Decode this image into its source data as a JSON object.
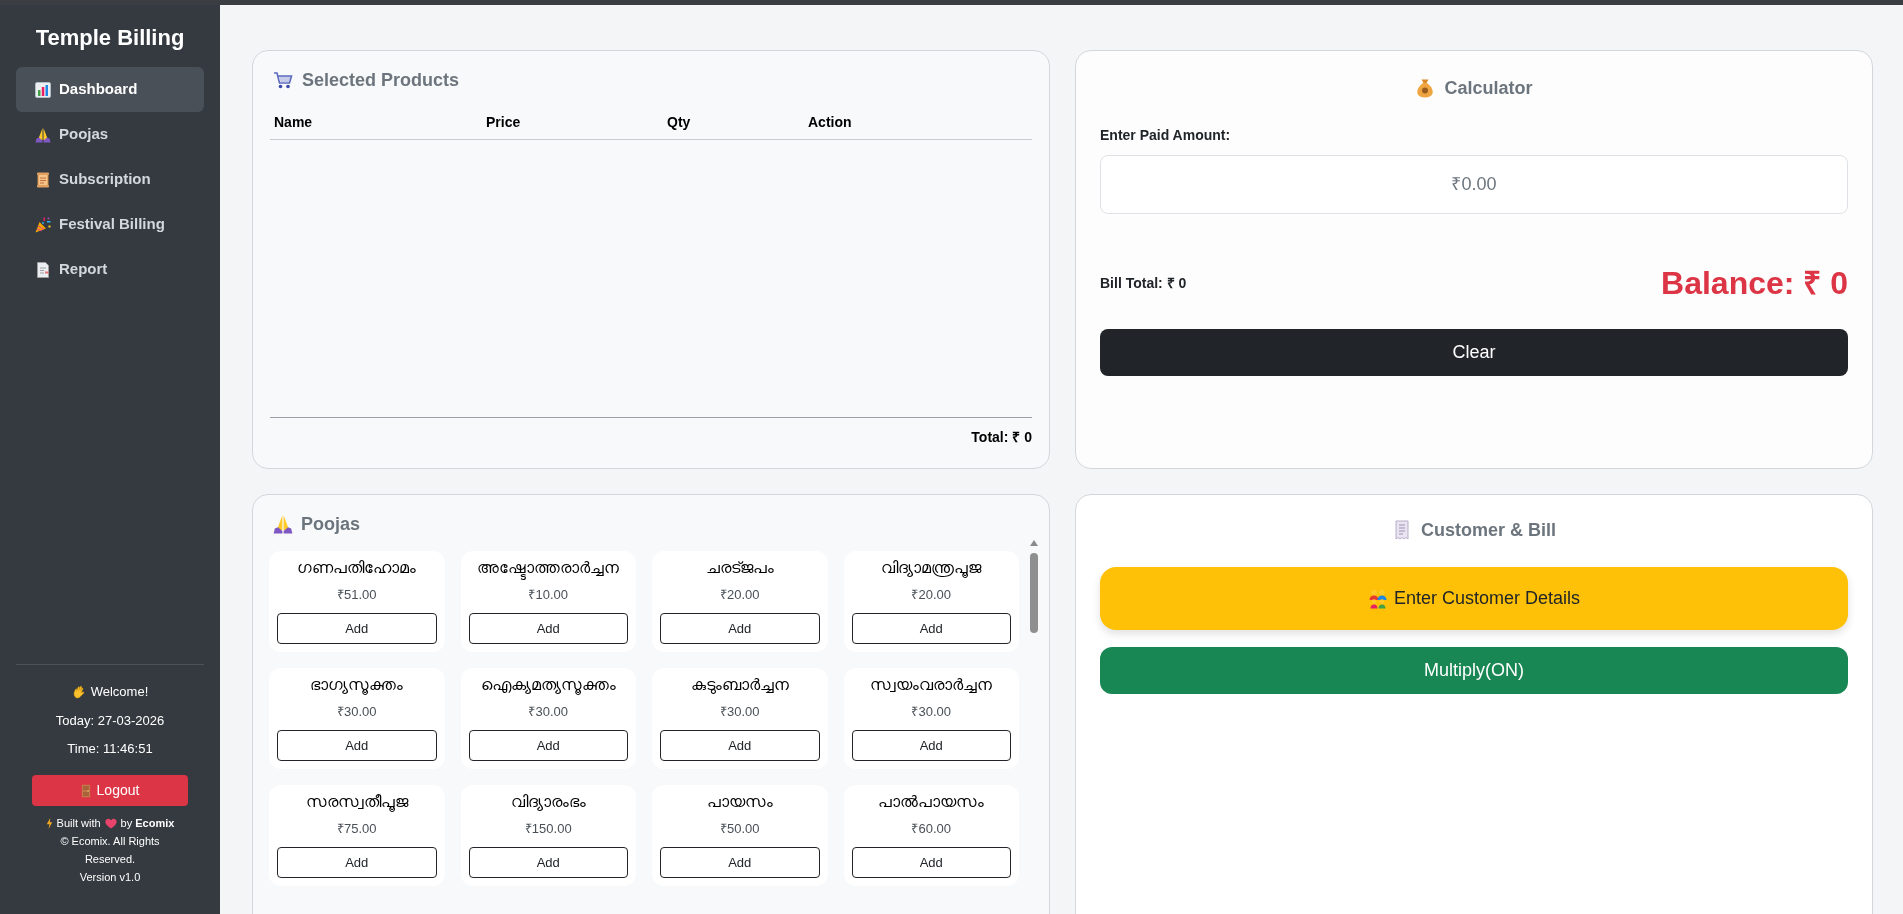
{
  "sidebar": {
    "title": "Temple Billing",
    "items": [
      {
        "label": "Dashboard",
        "selected": true
      },
      {
        "label": "Poojas",
        "selected": false
      },
      {
        "label": "Subscription",
        "selected": false
      },
      {
        "label": "Festival Billing",
        "selected": false
      },
      {
        "label": "Report",
        "selected": false
      }
    ],
    "welcome": "Welcome!",
    "today": "Today: 27-03-2026",
    "time": "Time: 11:46:51",
    "logout_button": "Logout",
    "credit": {
      "before": "Built with",
      "after": "by **Ecomix**"
    },
    "copyright": "© Ecomix. All Rights Reserved.",
    "version": "Version v1.0"
  },
  "selected_products": {
    "title": "Selected Products",
    "columns": [
      "Name",
      "Price",
      "Qty",
      "Action"
    ],
    "total": "Total: ₹ 0"
  },
  "calculator": {
    "title": "Calculator",
    "paid_label": "Enter Paid Amount:",
    "paid_input": {
      "placeholder": "₹0.00"
    },
    "bill_total": "Bill Total: ₹ 0",
    "balance": "Balance: ₹ 0",
    "clear_button": "Clear"
  },
  "poojas": {
    "title": "Poojas",
    "items": [
      {
        "name": "ഗണപതിഹോമം",
        "price": "₹51.00",
        "button": "Add"
      },
      {
        "name": "അഷ്ടോത്തരാർച്ചന",
        "price": "₹10.00",
        "button": "Add"
      },
      {
        "name": "ചരട്ജപം",
        "price": "₹20.00",
        "button": "Add"
      },
      {
        "name": "വിദ്യാമന്ത്രപൂജ",
        "price": "₹20.00",
        "button": "Add"
      },
      {
        "name": "ഭാഗ്യസൂക്തം",
        "price": "₹30.00",
        "button": "Add"
      },
      {
        "name": "ഐക്യമത്യസൂക്തം",
        "price": "₹30.00",
        "button": "Add"
      },
      {
        "name": "കുടുംബാർച്ചന",
        "price": "₹30.00",
        "button": "Add"
      },
      {
        "name": "സ്വയംവരാർച്ചന",
        "price": "₹30.00",
        "button": "Add"
      },
      {
        "name": "സരസ്വതീപൂജ",
        "price": "₹75.00",
        "button": "Add"
      },
      {
        "name": "വിദ്യാരംഭം",
        "price": "₹150.00",
        "button": "Add"
      },
      {
        "name": "പായസം",
        "price": "₹50.00",
        "button": "Add"
      },
      {
        "name": "പാൽപായസം",
        "price": "₹60.00",
        "button": "Add"
      }
    ]
  },
  "customer_bill": {
    "title": "Customer & Bill",
    "customer_button": "Enter Customer Details",
    "multiply_button": "Multiply(ON)"
  }
}
